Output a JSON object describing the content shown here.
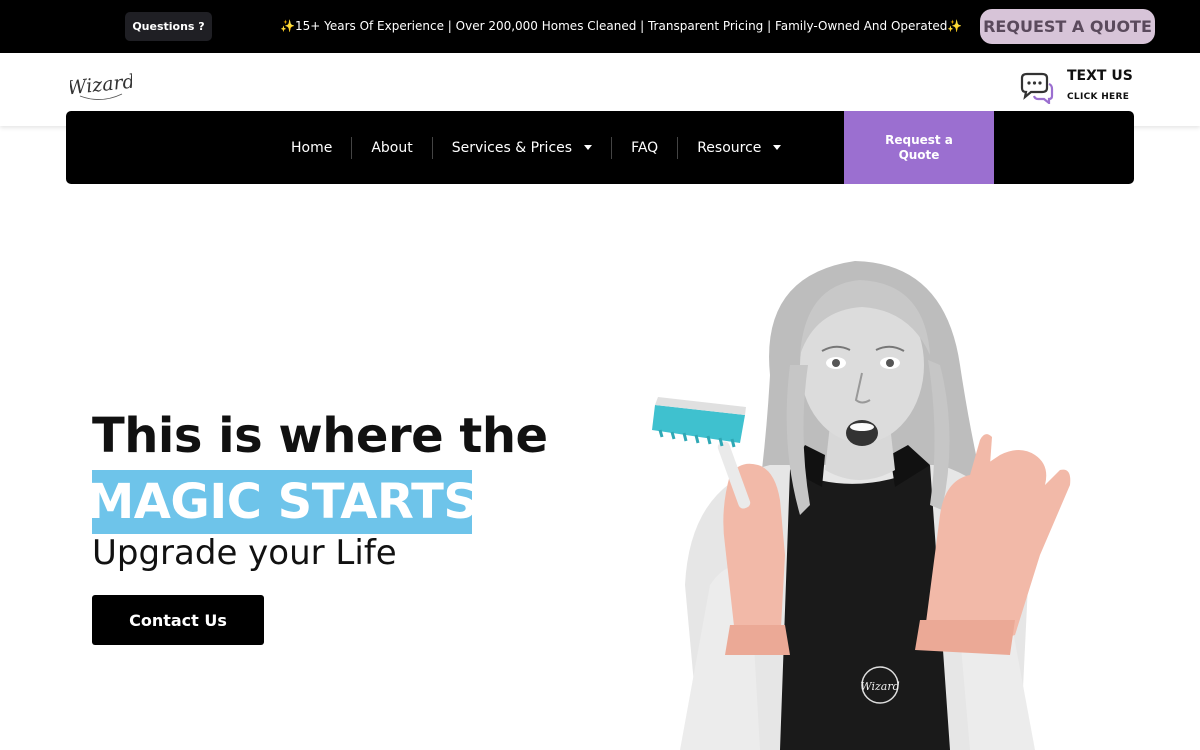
{
  "topbar": {
    "questions_label": "Questions ?",
    "announcement": "15+ Years Of Experience | Over 200,000 Homes Cleaned | Transparent Pricing | Family-Owned And Operated",
    "sparkle": "✨",
    "quote_button": "REQUEST A QUOTE"
  },
  "header": {
    "logo_text": "Wizard",
    "text_us_title": "TEXT US",
    "text_us_sub": "CLICK HERE",
    "chat_icon": "chat-bubbles-icon"
  },
  "nav": {
    "items": [
      {
        "label": "Home",
        "dropdown": false
      },
      {
        "label": "About",
        "dropdown": false
      },
      {
        "label": "Services & Prices",
        "dropdown": true
      },
      {
        "label": "FAQ",
        "dropdown": false
      },
      {
        "label": "Resource",
        "dropdown": true
      }
    ],
    "quote_line1": "Request a",
    "quote_line2": "Quote"
  },
  "hero": {
    "headline": "This is where the",
    "highlight": "MAGIC STARTS",
    "subheadline": "Upgrade your Life",
    "cta": "Contact Us",
    "apron_logo_text": "Wizard"
  },
  "colors": {
    "accent_purple": "#9b6fd0",
    "highlight_blue": "#6ec4ea",
    "quote_pink": "#d7c4d8",
    "brush_teal": "#3fc1cf",
    "glove_pink": "#f2b9a8"
  }
}
